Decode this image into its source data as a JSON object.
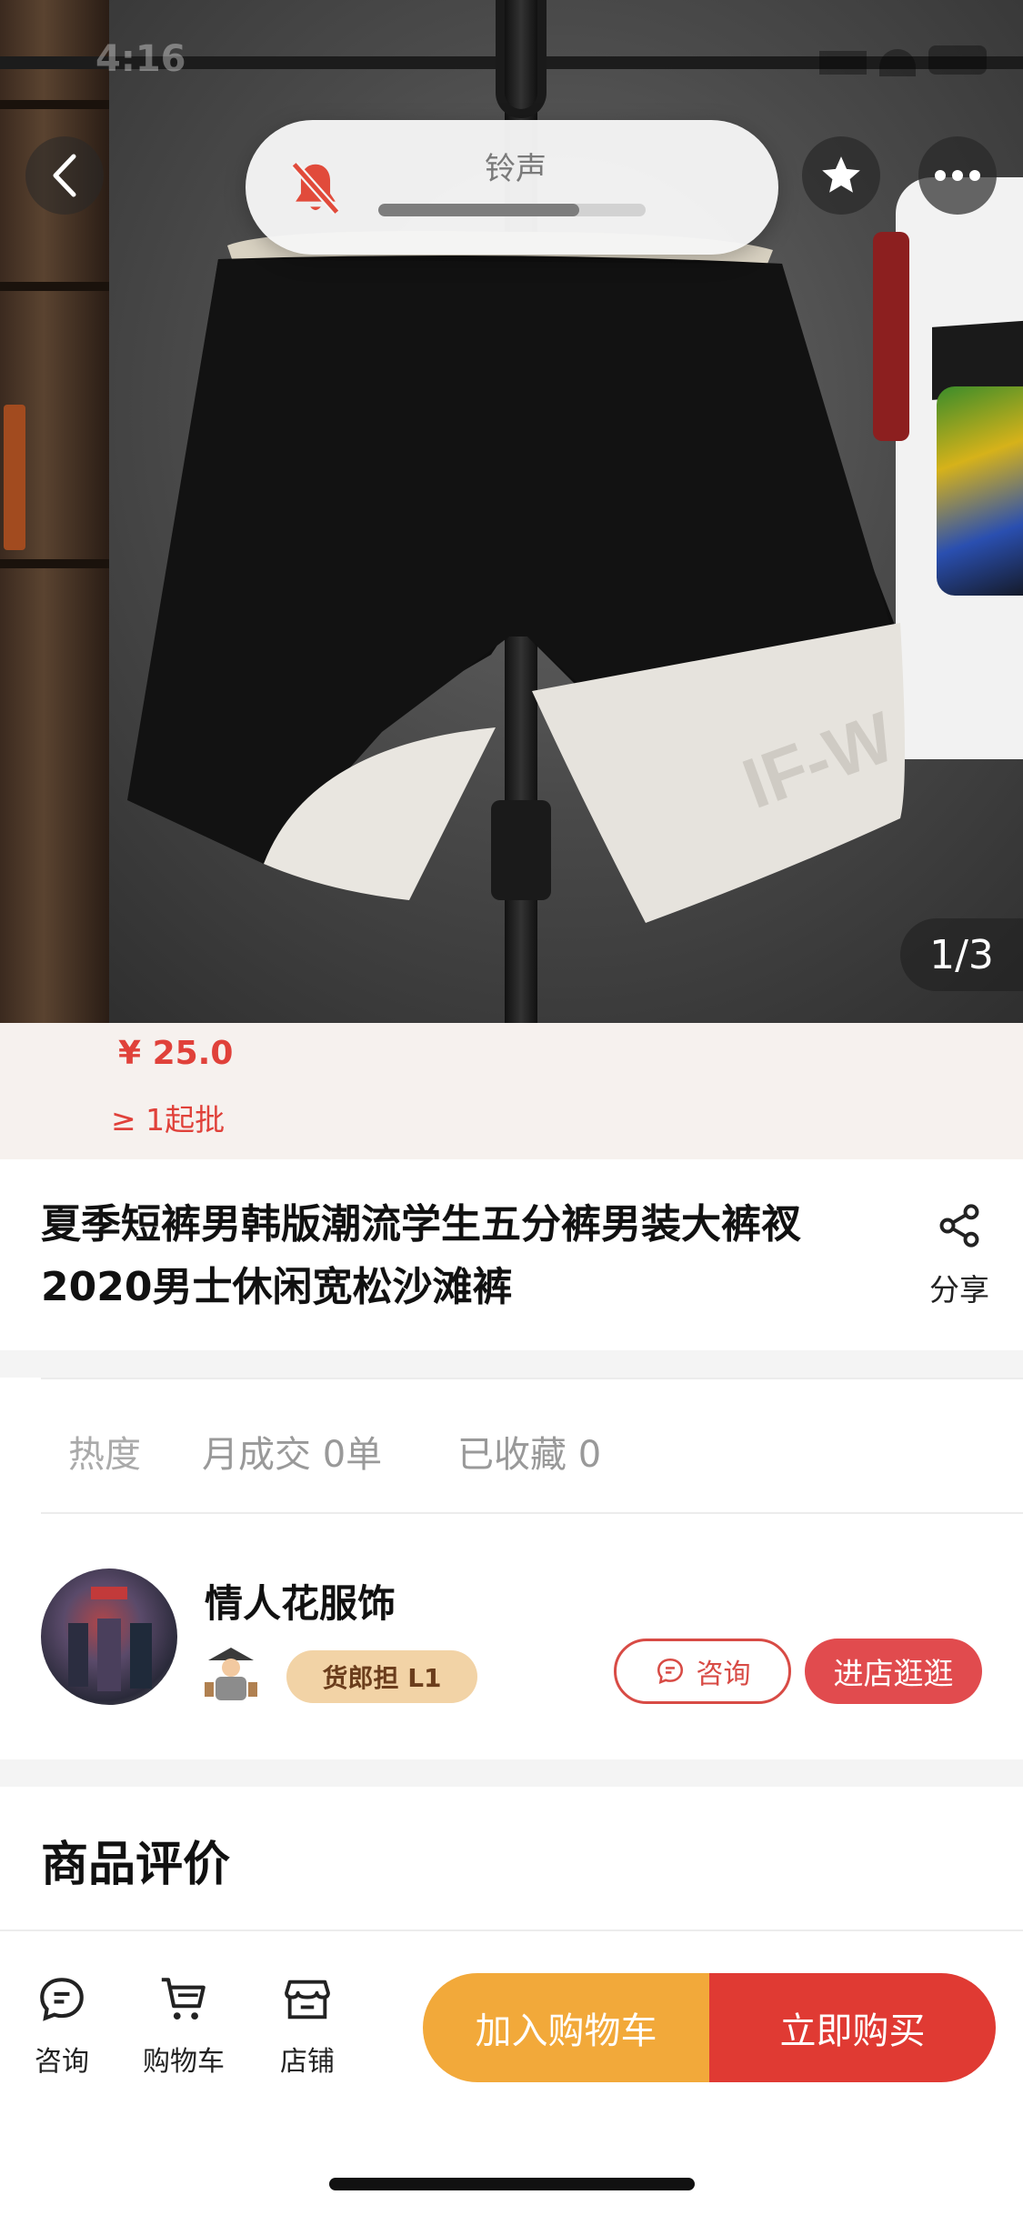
{
  "status_bar": {
    "time": "4:16"
  },
  "hero": {
    "image_counter": "1/3",
    "print_text": "IF-W"
  },
  "ringer_hud": {
    "label": "铃声",
    "volume": 0.75
  },
  "price": {
    "amount": "¥ 25.0",
    "moq": "≥ 1起批"
  },
  "product": {
    "title_line1": "夏季短裤男韩版潮流学生五分裤男装大裤衩",
    "title_line2": "2020男士休闲宽松沙滩裤",
    "share_label": "分享"
  },
  "stats": {
    "heat_label": "热度",
    "monthly_sales": "月成交 0单",
    "favorites": "已收藏 0"
  },
  "shop": {
    "name": "情人花服饰",
    "badge": "货郎担 L1",
    "consult_button": "咨询",
    "enter_button": "进店逛逛"
  },
  "reviews": {
    "title": "商品评价"
  },
  "bottom_bar": {
    "tabs": [
      {
        "label": "咨询",
        "icon": "chat-icon"
      },
      {
        "label": "购物车",
        "icon": "cart-icon"
      },
      {
        "label": "店铺",
        "icon": "store-icon"
      }
    ],
    "add_to_cart": "加入购物车",
    "buy_now": "立即购买"
  },
  "colors": {
    "accent_red": "#e03a33",
    "accent_orange": "#f2a93a",
    "price_red": "#e0413a",
    "badge_bg": "#f2d3a6"
  }
}
